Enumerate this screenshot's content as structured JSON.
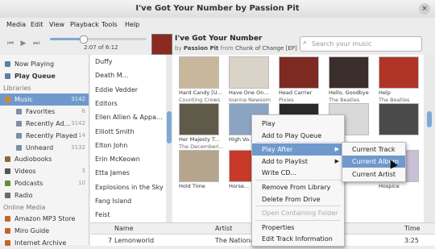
{
  "window": {
    "title": "I've Got Your Number by Passion Pit",
    "close_glyph": "×"
  },
  "menubar": [
    "Media",
    "Edit",
    "View",
    "Playback",
    "Tools",
    "Help"
  ],
  "player": {
    "time": "2:07 of 6:12",
    "progress": 0.34,
    "track_title": "I've Got Your Number",
    "by": "by",
    "artist": "Passion Pit",
    "from": "from",
    "album": "Chunk of Change [EP]"
  },
  "search": {
    "placeholder": "Search your music"
  },
  "sidebar": [
    {
      "label": "Now Playing",
      "type": "item",
      "icon": "speaker-icon"
    },
    {
      "label": "Play Queue",
      "type": "item",
      "bold": true,
      "icon": "queue-icon"
    },
    {
      "label": "Libraries",
      "type": "header"
    },
    {
      "label": "Music",
      "count": "3142",
      "type": "item",
      "selected": true,
      "icon": "music-icon"
    },
    {
      "label": "Favorites",
      "count": "6",
      "type": "child",
      "icon": "playlist-icon"
    },
    {
      "label": "Recently Ad...",
      "count": "3142",
      "type": "child",
      "icon": "playlist-icon"
    },
    {
      "label": "Recently Played",
      "count": "14",
      "type": "child",
      "icon": "playlist-icon"
    },
    {
      "label": "Unheard",
      "count": "3132",
      "type": "child",
      "icon": "playlist-icon"
    },
    {
      "label": "Audiobooks",
      "type": "item",
      "icon": "book-icon"
    },
    {
      "label": "Videos",
      "count": "3",
      "type": "item",
      "icon": "video-icon"
    },
    {
      "label": "Podcasts",
      "count": "10",
      "type": "item",
      "icon": "podcast-icon"
    },
    {
      "label": "Radio",
      "type": "item",
      "icon": "radio-icon"
    },
    {
      "label": "Online Media",
      "type": "header"
    },
    {
      "label": "Amazon MP3 Store",
      "type": "item",
      "icon": "store-icon"
    },
    {
      "label": "Miro Guide",
      "type": "item",
      "icon": "store-icon"
    },
    {
      "label": "Internet Archive",
      "type": "item",
      "icon": "store-icon"
    }
  ],
  "artists": [
    "Duffy",
    "Death M...",
    "Eddie Vedder",
    "Editors",
    "Ellen Allien & Appa...",
    "Elliott Smith",
    "Elton John",
    "Erin McKeown",
    "Etta James",
    "Explosions in the Sky",
    "Fang Island",
    "Feist"
  ],
  "albums": [
    {
      "title": "Hard Candy [U...",
      "artist": "Counting Crows",
      "color": "#c9b79c"
    },
    {
      "title": "Have One On...",
      "artist": "Ioanna Newsom",
      "color": "#d9d4c7"
    },
    {
      "title": "Head Carrier",
      "artist": "Pixies",
      "color": "#7d2a22"
    },
    {
      "title": "Hello, Goodbye",
      "artist": "The Beatles",
      "color": "#3a2f2a"
    },
    {
      "title": "Help",
      "artist": "The Beatles",
      "color": "#b03526"
    },
    {
      "title": "Her Majesty T...",
      "artist": "The Decemberi...",
      "color": "#5f5a49"
    },
    {
      "title": "High Vo...",
      "artist": "",
      "color": "#8aa4c2"
    },
    {
      "title": "",
      "artist": "",
      "color": "#2a2a2a"
    },
    {
      "title": "",
      "artist": "",
      "color": "#d8d8d8"
    },
    {
      "title": "",
      "artist": "",
      "color": "#4a4a4a"
    },
    {
      "title": "Hold Time",
      "artist": "",
      "color": "#b5a58c"
    },
    {
      "title": "Horse...",
      "artist": "",
      "color": "#c73a2a"
    },
    {
      "title": "",
      "artist": "",
      "color": "#2a2a2a"
    },
    {
      "title": "",
      "artist": "",
      "color": "#3a3a3a"
    },
    {
      "title": "Hospice",
      "artist": "",
      "color": "#c9c0d6"
    }
  ],
  "tracks": {
    "headers": {
      "name": "Name",
      "artist": "Artist",
      "time": "Time"
    },
    "rows": [
      {
        "num": "7",
        "name": "Lemonworld",
        "artist": "The Nationa...",
        "time": "3:25"
      }
    ]
  },
  "context_menu": [
    {
      "label": "Play"
    },
    {
      "label": "Add to Play Queue"
    },
    {
      "label": "Play After",
      "submenu": true,
      "selected": true
    },
    {
      "label": "Add to Playlist",
      "submenu": true
    },
    {
      "label": "Write CD..."
    },
    {
      "label": "Remove From Library"
    },
    {
      "label": "Delete From Drive"
    },
    {
      "label": "Open Containing Folder",
      "disabled": true
    },
    {
      "label": "Properties"
    },
    {
      "label": "Edit Track Information"
    }
  ],
  "submenu": [
    {
      "label": "Current Track"
    },
    {
      "label": "Current Album",
      "selected": true
    },
    {
      "label": "Current Artist"
    }
  ]
}
